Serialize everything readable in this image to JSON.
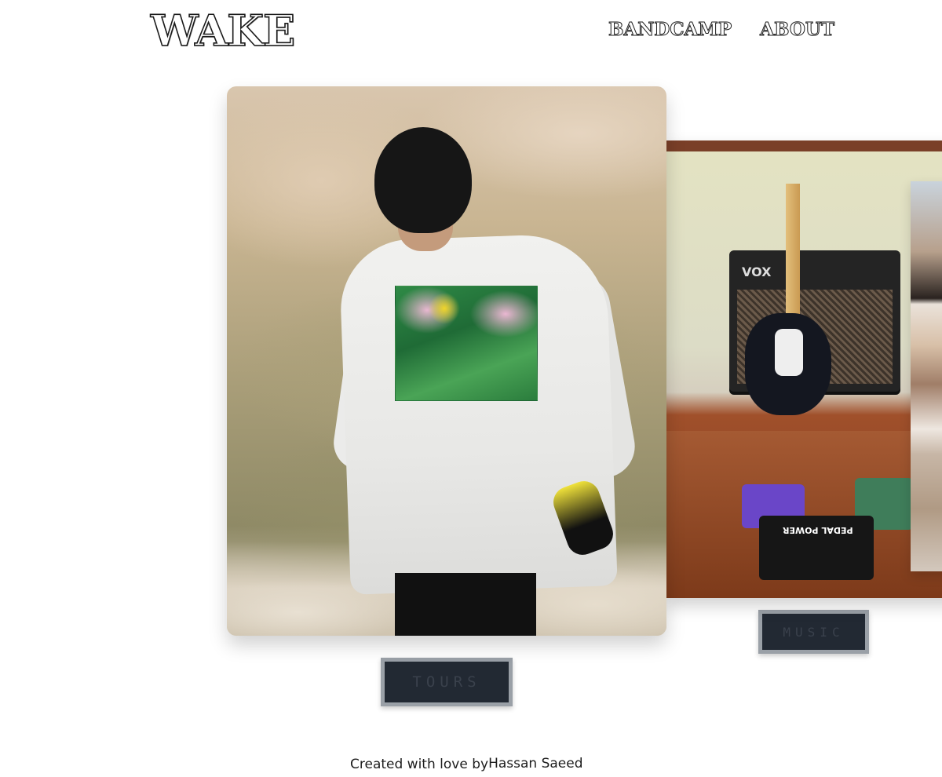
{
  "header": {
    "logo": "WAKE",
    "nav": [
      {
        "label": "BANDCAMP"
      },
      {
        "label": "ABOUT"
      }
    ]
  },
  "cards": {
    "tours": {
      "label": "TOURS"
    },
    "music": {
      "label": "MUSIC",
      "amp_brand": "VOX",
      "pedal_label": "PEDAL POWER"
    }
  },
  "footer": {
    "prefix": "Created with love by",
    "author": "Hassan Saeed"
  }
}
